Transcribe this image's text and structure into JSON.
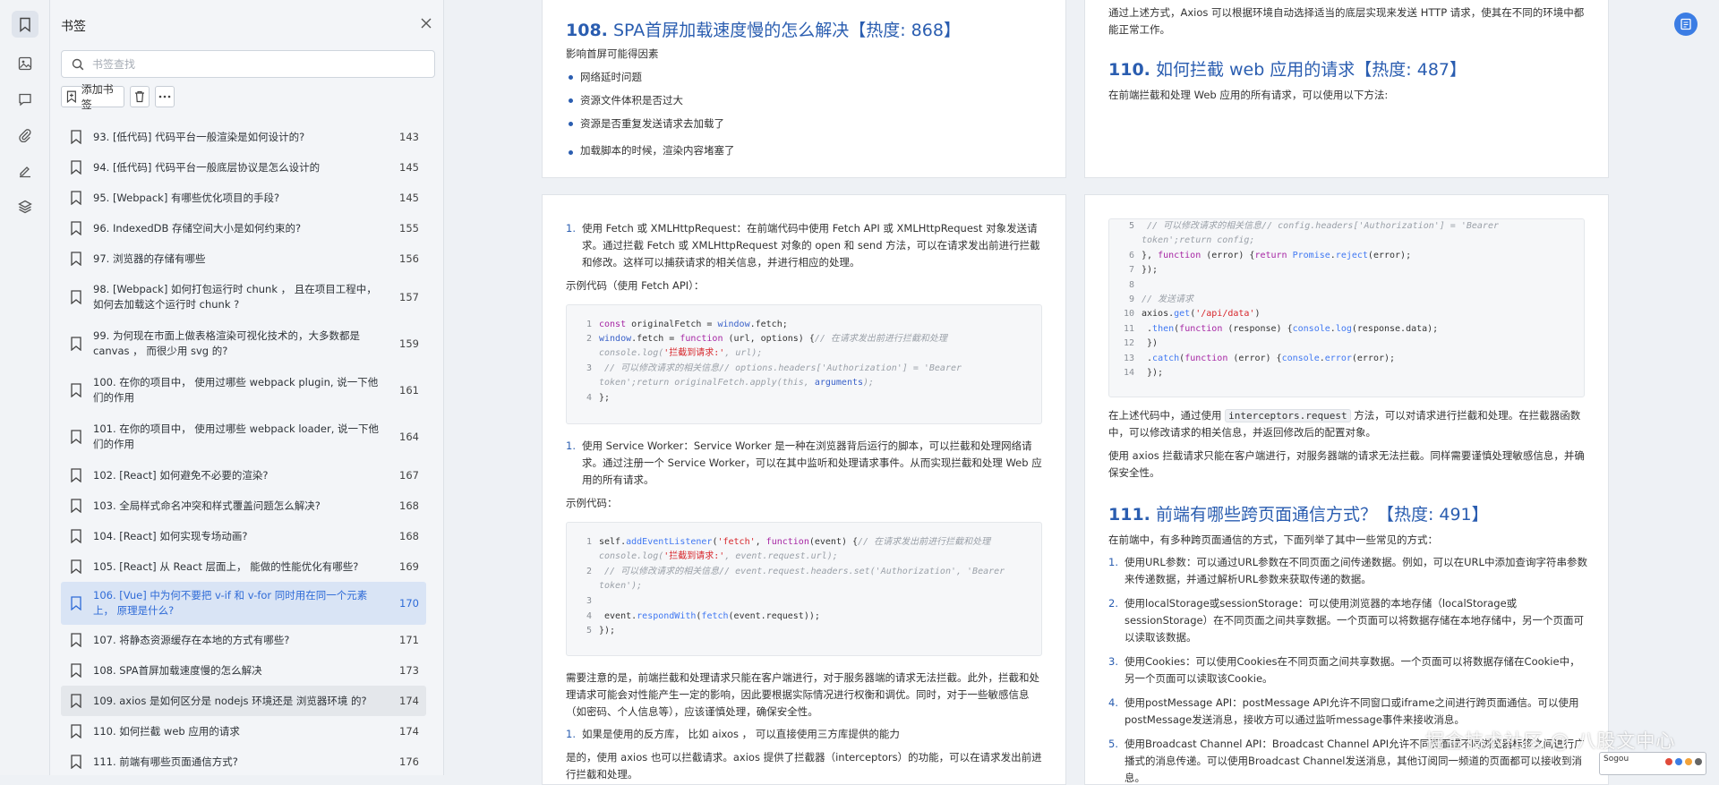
{
  "sidebar": {
    "title": "书签",
    "search_placeholder": "书签查找",
    "add_bookmark_label": "添加书签",
    "items": [
      {
        "label": "93. [低代码] 代码平台一般渲染是如何设计的?",
        "page": "143"
      },
      {
        "label": "94. [低代码] 代码平台一般底层协议是怎么设计的",
        "page": "145"
      },
      {
        "label": "95. [Webpack] 有哪些优化项目的手段?",
        "page": "145"
      },
      {
        "label": "96. IndexedDB 存储空间大小是如何约束的?",
        "page": "155"
      },
      {
        "label": "97. 浏览器的存储有哪些",
        "page": "156"
      },
      {
        "label": "98. [Webpack] 如何打包运行时 chunk ， 且在项目工程中，如何去加载这个运行时 chunk ?",
        "page": "157"
      },
      {
        "label": "99. 为何现在市面上做表格渲染可视化技术的，大多数都是 canvas ， 而很少用 svg 的?",
        "page": "159"
      },
      {
        "label": "100. 在你的项目中， 使用过哪些 webpack plugin, 说一下他们的作用",
        "page": "161"
      },
      {
        "label": "101. 在你的项目中， 使用过哪些 webpack loader, 说一下他们的作用",
        "page": "164"
      },
      {
        "label": "102. [React] 如何避免不必要的渲染?",
        "page": "167"
      },
      {
        "label": "103. 全局样式命名冲突和样式覆盖问题怎么解决?",
        "page": "168"
      },
      {
        "label": "104. [React] 如何实现专场动画?",
        "page": "168"
      },
      {
        "label": "105. [React] 从 React 层面上， 能做的性能优化有哪些?",
        "page": "169"
      },
      {
        "label": "106. [Vue] 中为何不要把 v-if 和 v-for 同时用在同一个元素上， 原理是什么?",
        "page": "170"
      },
      {
        "label": "107. 将静态资源缓存在本地的方式有哪些?",
        "page": "171"
      },
      {
        "label": "108. SPA首屏加载速度慢的怎么解决",
        "page": "173"
      },
      {
        "label": "109. axios 是如何区分是 nodejs 环境还是 浏览器环境 的?",
        "page": "174"
      },
      {
        "label": "110. 如何拦截 web 应用的请求",
        "page": "174"
      },
      {
        "label": "111. 前端有哪些页面通信方式?",
        "page": "176"
      }
    ]
  },
  "doc": {
    "p1": {
      "heading_num": "108.",
      "heading_text": "SPA首屏加载速度慢的怎么解决【热度: 868】",
      "intro": "影响首屏可能得因素",
      "bullets": [
        "网络延时问题",
        "资源文件体积是否过大",
        "资源是否重复发送请求去加载了",
        "加载脚本的时候，渲染内容堵塞了"
      ]
    },
    "p2": {
      "top_text": "通过上述方式，Axios 可以根据环境自动选择适当的底层实现来发送 HTTP 请求，使其在不同的环境中都能正常工作。",
      "heading_num": "110.",
      "heading_text": "如何拦截 web 应用的请求【热度: 487】",
      "intro": "在前端拦截和处理 Web 应用的所有请求，可以使用以下方法:"
    },
    "p3": {
      "item1_num": "1.",
      "item1": "使用 Fetch 或 XMLHttpRequest：在前端代码中使用 Fetch API 或 XMLHttpRequest 对象发送请求。通过拦截 Fetch 或 XMLHttpRequest 对象的 open 和 send 方法，可以在请求发出前进行拦截和修改。这样可以捕获请求的相关信息，并进行相应的处理。",
      "example1": "示例代码（使用 Fetch API）：",
      "item2_num": "1.",
      "item2": "使用 Service Worker：Service Worker 是一种在浏览器背后运行的脚本，可以拦截和处理网络请求。通过注册一个 Service Worker，可以在其中监听和处理请求事件。从而实现拦截和处理 Web 应用的所有请求。",
      "example2": "示例代码：",
      "note": "需要注意的是，前端拦截和处理请求只能在客户端进行，对于服务器端的请求无法拦截。此外，拦截和处理请求可能会对性能产生一定的影响，因此要根据实际情况进行权衡和调优。同时，对于一些敏感信息（如密码、个人信息等），应该谨慎处理，确保安全性。",
      "item3_num": "1.",
      "item3": "如果是使用的反方库， 比如 aixos ， 可以直接使用三方库提供的能力",
      "tail": "是的，使用 axios 也可以拦截请求。axios 提供了拦截器（interceptors）的功能，可以在请求发出前进行拦截和处理。"
    },
    "p4": {
      "para1_a": "在上述代码中，通过使用",
      "para1_code": "interceptors.request",
      "para1_b": "方法，可以对请求进行拦截和处理。在拦截器函数中，可以修改请求的相关信息，并返回修改后的配置对象。",
      "para2": "使用 axios 拦截请求只能在客户端进行，对服务器端的请求无法拦截。同样需要谨慎处理敏感信息，并确保安全性。",
      "heading_num": "111.",
      "heading_text": "前端有哪些跨页面通信方式？【热度: 491】",
      "intro": "在前端中，有多种跨页面通信的方式，下面列举了其中一些常见的方式：",
      "items": [
        {
          "n": "1.",
          "text": "使用URL参数：可以通过URL参数在不同页面之间传递数据。例如，可以在URL中添加查询字符串参数来传递数据，并通过解析URL参数来获取传递的数据。"
        },
        {
          "n": "2.",
          "text": "使用localStorage或sessionStorage：可以使用浏览器的本地存储（localStorage或sessionStorage）在不同页面之间共享数据。一个页面可以将数据存储在本地存储中，另一个页面可以读取该数据。"
        },
        {
          "n": "3.",
          "text": "使用Cookies：可以使用Cookies在不同页面之间共享数据。一个页面可以将数据存储在Cookie中，另一个页面可以读取该Cookie。"
        },
        {
          "n": "4.",
          "text": "使用postMessage API：postMessage API允许不同窗口或iframe之间进行跨页面通信。可以使用postMessage发送消息，接收方可以通过监听message事件来接收消息。"
        },
        {
          "n": "5.",
          "text": "使用Broadcast Channel API：Broadcast Channel API允许不同页面或不同浏览器标签之间进行广播式的消息传递。可以使用Broadcast Channel发送消息，其他订阅同一频道的页面都可以接收到消息。"
        }
      ]
    }
  },
  "watermark": "掘金技术社区 @ 八股文中心",
  "ime_label": "Sogou"
}
